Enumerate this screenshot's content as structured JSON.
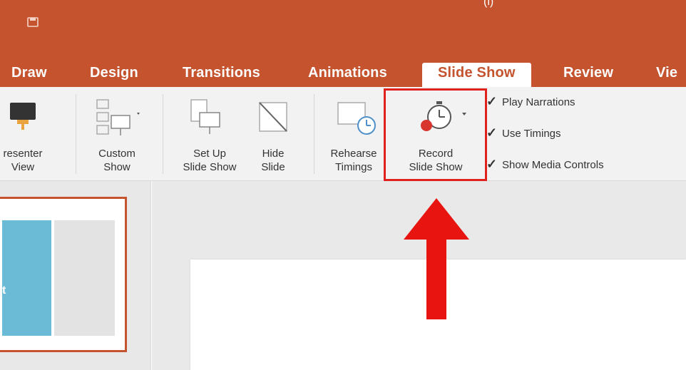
{
  "titlebar": {
    "partial_text": "(i)",
    "qat_icon": "save-icon"
  },
  "tabs": [
    {
      "label": "Draw"
    },
    {
      "label": "Design"
    },
    {
      "label": "Transitions"
    },
    {
      "label": "Animations"
    },
    {
      "label": "Slide Show",
      "active": true
    },
    {
      "label": "Review"
    },
    {
      "label": "Vie"
    }
  ],
  "ribbon": {
    "presenter_view": "resenter\nView",
    "custom_show": "Custom\nShow",
    "setup_show": "Set Up\nSlide Show",
    "hide_slide": "Hide\nSlide",
    "rehearse": "Rehearse\nTimings",
    "record": "Record\nSlide Show",
    "checks": [
      "Play Narrations",
      "Use Timings",
      "Show Media Controls"
    ]
  },
  "thumbnail": {
    "label": "t"
  },
  "colors": {
    "brand": "#c4532e",
    "highlight": "#e0221f",
    "thumb_blue": "#6bbad6"
  }
}
